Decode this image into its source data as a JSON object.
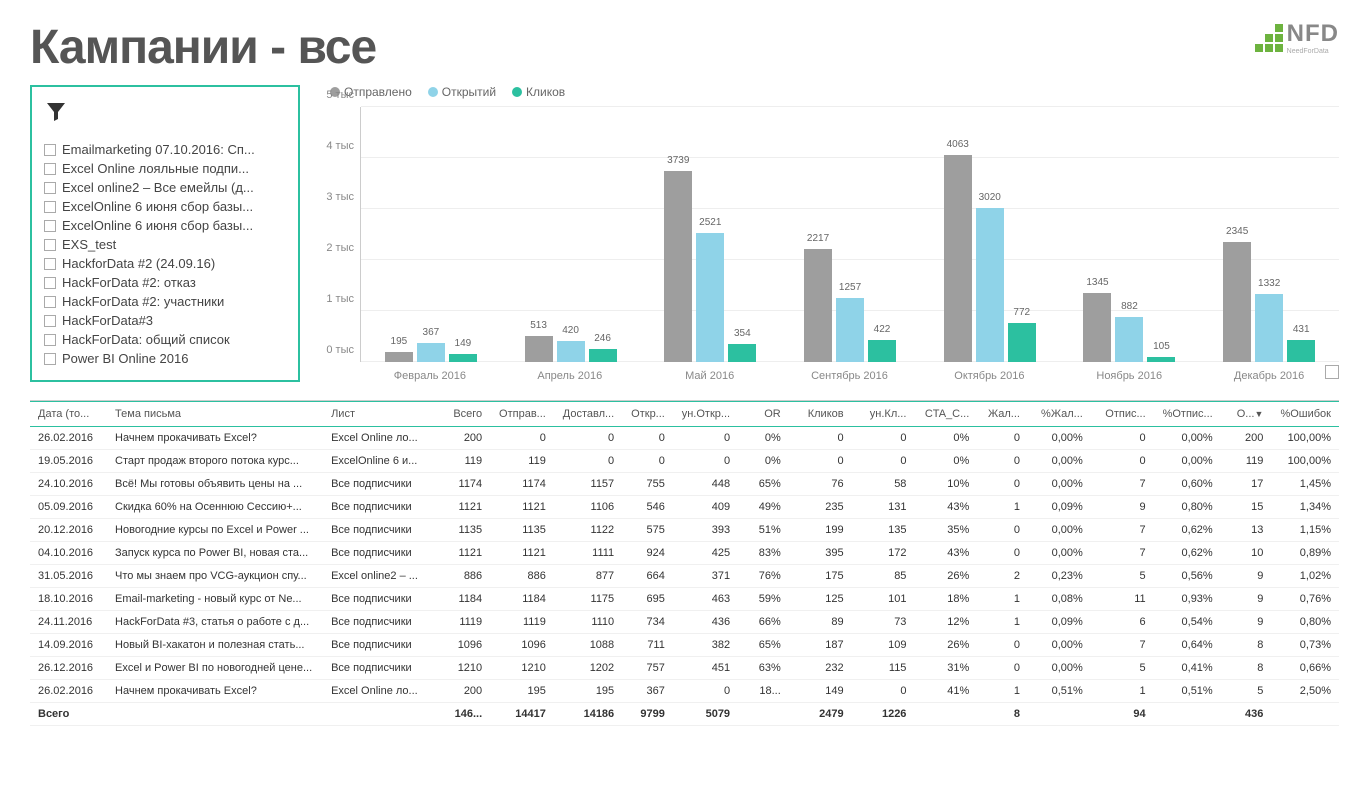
{
  "title": "Кампании - все",
  "logo": {
    "text": "NFD",
    "sub": "NeedForData"
  },
  "filter": {
    "items": [
      "Emailmarketing 07.10.2016: Сп...",
      "Excel Online лояльные подпи...",
      "Excel online2 – Все емейлы (д...",
      "ExcelOnline 6 июня сбор базы...",
      "ExcelOnline 6 июня сбор базы...",
      "EXS_test",
      "HackforData #2 (24.09.16)",
      "HackForData #2: отказ",
      "HackForData #2: участники",
      "HackForData#3",
      "HackForData: общий список",
      "Power BI Online 2016"
    ]
  },
  "chart_legend": {
    "series": [
      {
        "name": "Отправлено",
        "color": "#9e9e9e"
      },
      {
        "name": "Открытий",
        "color": "#8fd3e8"
      },
      {
        "name": "Кликов",
        "color": "#2cc0a0"
      }
    ]
  },
  "chart_data": {
    "type": "bar",
    "title": "",
    "xlabel": "",
    "ylabel": "",
    "ylim": [
      0,
      5000
    ],
    "yticks": [
      "0 тыс",
      "1 тыс",
      "2 тыс",
      "3 тыс",
      "4 тыс",
      "5 тыс"
    ],
    "categories": [
      "Февраль 2016",
      "Апрель 2016",
      "Май 2016",
      "Сентябрь 2016",
      "Октябрь 2016",
      "Ноябрь 2016",
      "Декабрь 2016"
    ],
    "series": [
      {
        "name": "Отправлено",
        "color": "#9e9e9e",
        "values": [
          195,
          513,
          3739,
          2217,
          4063,
          1345,
          2345
        ]
      },
      {
        "name": "Открытий",
        "color": "#8fd3e8",
        "values": [
          367,
          420,
          2521,
          1257,
          3020,
          882,
          1332
        ]
      },
      {
        "name": "Кликов",
        "color": "#2cc0a0",
        "values": [
          149,
          246,
          354,
          422,
          772,
          105,
          431
        ]
      }
    ]
  },
  "table": {
    "headers": [
      "Дата (то...",
      "Тема письма",
      "Лист",
      "Всего",
      "Отправ...",
      "Доставл...",
      "Откр...",
      "ун.Откр...",
      "OR",
      "Кликов",
      "ун.Кл...",
      "CTA_C...",
      "Жал...",
      "%Жал...",
      "Отпис...",
      "%Отпис...",
      "О...",
      "%Ошибок"
    ],
    "sort_col": 16,
    "rows": [
      [
        "26.02.2016",
        "Начнем прокачивать Excel?",
        "Excel Online ло...",
        "200",
        "0",
        "0",
        "0",
        "0",
        "0%",
        "0",
        "0",
        "0%",
        "0",
        "0,00%",
        "0",
        "0,00%",
        "200",
        "100,00%"
      ],
      [
        "19.05.2016",
        "Старт продаж второго потока курс...",
        "ExcelOnline 6 и...",
        "119",
        "119",
        "0",
        "0",
        "0",
        "0%",
        "0",
        "0",
        "0%",
        "0",
        "0,00%",
        "0",
        "0,00%",
        "119",
        "100,00%"
      ],
      [
        "24.10.2016",
        "Всё! Мы готовы объявить цены на ...",
        "Все подписчики",
        "1174",
        "1174",
        "1157",
        "755",
        "448",
        "65%",
        "76",
        "58",
        "10%",
        "0",
        "0,00%",
        "7",
        "0,60%",
        "17",
        "1,45%"
      ],
      [
        "05.09.2016",
        "Скидка 60% на Осеннюю Сессию+...",
        "Все подписчики",
        "1121",
        "1121",
        "1106",
        "546",
        "409",
        "49%",
        "235",
        "131",
        "43%",
        "1",
        "0,09%",
        "9",
        "0,80%",
        "15",
        "1,34%"
      ],
      [
        "20.12.2016",
        "Новогодние курсы по Excel и Power ...",
        "Все подписчики",
        "1135",
        "1135",
        "1122",
        "575",
        "393",
        "51%",
        "199",
        "135",
        "35%",
        "0",
        "0,00%",
        "7",
        "0,62%",
        "13",
        "1,15%"
      ],
      [
        "04.10.2016",
        "Запуск курса по Power BI, новая ста...",
        "Все подписчики",
        "1121",
        "1121",
        "1111",
        "924",
        "425",
        "83%",
        "395",
        "172",
        "43%",
        "0",
        "0,00%",
        "7",
        "0,62%",
        "10",
        "0,89%"
      ],
      [
        "31.05.2016",
        "Что мы знаем про VCG-аукцион спу...",
        "Excel online2 – ...",
        "886",
        "886",
        "877",
        "664",
        "371",
        "76%",
        "175",
        "85",
        "26%",
        "2",
        "0,23%",
        "5",
        "0,56%",
        "9",
        "1,02%"
      ],
      [
        "18.10.2016",
        "Email-marketing - новый курс от Ne...",
        "Все подписчики",
        "1184",
        "1184",
        "1175",
        "695",
        "463",
        "59%",
        "125",
        "101",
        "18%",
        "1",
        "0,08%",
        "11",
        "0,93%",
        "9",
        "0,76%"
      ],
      [
        "24.11.2016",
        "HackForData #3, статья о работе с д...",
        "Все подписчики",
        "1119",
        "1119",
        "1110",
        "734",
        "436",
        "66%",
        "89",
        "73",
        "12%",
        "1",
        "0,09%",
        "6",
        "0,54%",
        "9",
        "0,80%"
      ],
      [
        "14.09.2016",
        "Новый BI-хакатон и полезная стать...",
        "Все подписчики",
        "1096",
        "1096",
        "1088",
        "711",
        "382",
        "65%",
        "187",
        "109",
        "26%",
        "0",
        "0,00%",
        "7",
        "0,64%",
        "8",
        "0,73%"
      ],
      [
        "26.12.2016",
        "Excel и Power BI по новогодней цене...",
        "Все подписчики",
        "1210",
        "1210",
        "1202",
        "757",
        "451",
        "63%",
        "232",
        "115",
        "31%",
        "0",
        "0,00%",
        "5",
        "0,41%",
        "8",
        "0,66%"
      ],
      [
        "26.02.2016",
        "Начнем прокачивать Excel?",
        "Excel Online ло...",
        "200",
        "195",
        "195",
        "367",
        "0",
        "18...",
        "149",
        "0",
        "41%",
        "1",
        "0,51%",
        "1",
        "0,51%",
        "5",
        "2,50%"
      ]
    ],
    "footer": [
      "Всего",
      "",
      "",
      "146...",
      "14417",
      "14186",
      "9799",
      "5079",
      "",
      "2479",
      "1226",
      "",
      "8",
      "",
      "94",
      "",
      "436",
      ""
    ]
  }
}
